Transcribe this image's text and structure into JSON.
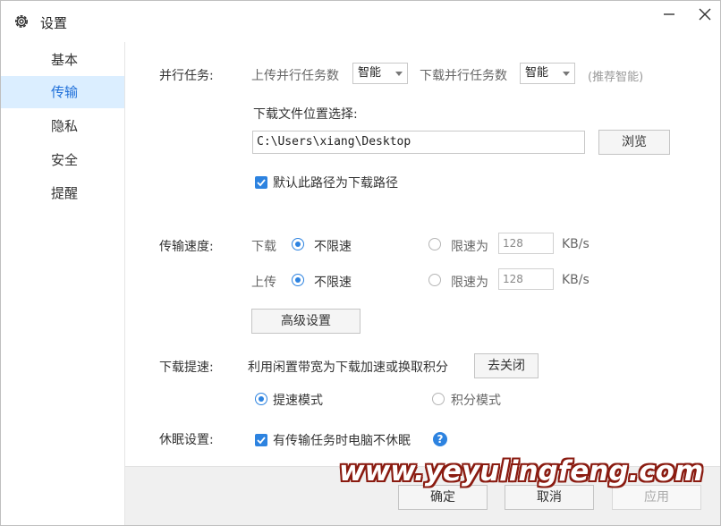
{
  "window": {
    "title": "设置",
    "icons": {
      "title": "gear-icon",
      "minimize": "minimize-icon",
      "close": "close-icon"
    }
  },
  "sidebar": {
    "items": [
      {
        "label": "基本",
        "active": false
      },
      {
        "label": "传输",
        "active": true
      },
      {
        "label": "隐私",
        "active": false
      },
      {
        "label": "安全",
        "active": false
      },
      {
        "label": "提醒",
        "active": false
      }
    ]
  },
  "parallel": {
    "label": "并行任务:",
    "upload_label": "上传并行任务数",
    "upload_value": "智能",
    "download_label": "下载并行任务数",
    "download_value": "智能",
    "hint": "(推荐智能)"
  },
  "download_location": {
    "label": "下载文件位置选择:",
    "path": "C:\\Users\\xiang\\Desktop",
    "browse_button": "浏览",
    "default_checkbox_label": "默认此路径为下载路径",
    "default_checked": true
  },
  "speed": {
    "label": "传输速度:",
    "download_label": "下载",
    "upload_label": "上传",
    "unlimited_label": "不限速",
    "limit_label": "限速为",
    "download_limit_value": "128",
    "upload_limit_value": "128",
    "unit": "KB/s",
    "advanced_button": "高级设置"
  },
  "boost": {
    "label": "下载提速:",
    "description": "利用闲置带宽为下载加速或换取积分",
    "toggle_button": "去关闭",
    "mode_speed": "提速模式",
    "mode_points": "积分模式"
  },
  "sleep": {
    "label": "休眠设置:",
    "checkbox_label": "有传输任务时电脑不休眠",
    "checked": true,
    "help_icon": "help-icon"
  },
  "footer": {
    "ok_button": "确定",
    "cancel_button": "取消",
    "apply_button": "应用"
  },
  "watermark": "www.yeyulingfeng.com",
  "colors": {
    "accent": "#2d83e0",
    "sidebar_active_bg": "#dbeeff",
    "watermark_outline": "#8a1b10"
  }
}
